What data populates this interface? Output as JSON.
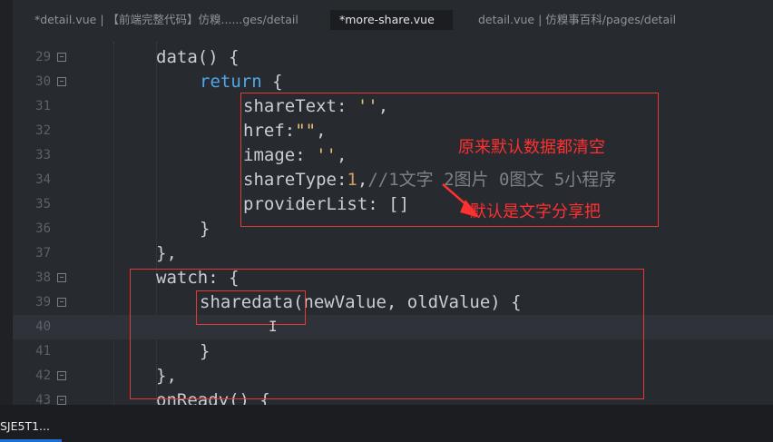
{
  "tabs": [
    {
      "label": "*detail.vue | 【前端完整代码】仿糗......ges/detail",
      "active": false
    },
    {
      "label": "*more-share.vue",
      "active": true
    },
    {
      "label": "detail.vue | 仿糗事百科/pages/detail",
      "active": false
    }
  ],
  "line_numbers": [
    "29",
    "30",
    "31",
    "32",
    "33",
    "34",
    "35",
    "36",
    "37",
    "38",
    "39",
    "40",
    "41",
    "42",
    "43"
  ],
  "code": {
    "l29": {
      "a": "data",
      "b": "() {"
    },
    "l30": {
      "kw": "return",
      "b": " {"
    },
    "l31": {
      "a": "shareText",
      "b": ": ",
      "s": "''",
      "c": ","
    },
    "l32": {
      "a": "href",
      "b": ":",
      "s": "\"\"",
      "c": ","
    },
    "l33": {
      "a": "image",
      "b": ": ",
      "s": "''",
      "c": ","
    },
    "l34": {
      "a": "shareType",
      "b": ":",
      "n": "1",
      "c": ",",
      "cm": "//1文字 2图片 0图文 5小程序"
    },
    "l35": {
      "a": "providerList",
      "b": ": []"
    },
    "l36": {
      "a": "}"
    },
    "l37": {
      "a": "},"
    },
    "l38": {
      "a": "watch",
      "b": ": {"
    },
    "l39": {
      "a": "sharedata",
      "b": "(newValue, oldValue) {"
    },
    "l40": {
      "a": ""
    },
    "l41": {
      "a": "}"
    },
    "l42": {
      "a": "},"
    },
    "l43": {
      "a": "onReady",
      "b": "() {"
    }
  },
  "annotations": {
    "note1": "原来默认数据都清空",
    "note2": "默认是文字分享把"
  },
  "taskbar": {
    "item": "SJE5T1..."
  },
  "colors": {
    "annotation": "#e53935",
    "keyword": "#4fa8e8",
    "string": "#e8c27a"
  }
}
